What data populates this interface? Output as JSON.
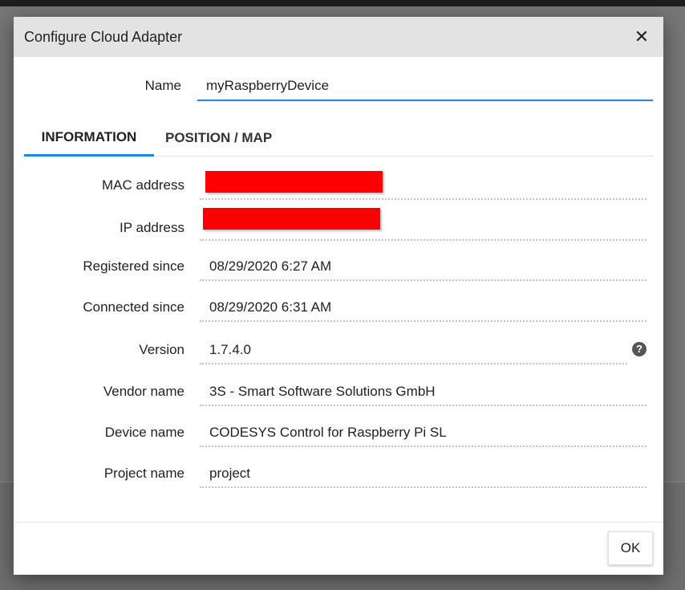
{
  "dialog": {
    "title": "Configure Cloud Adapter",
    "close_icon": "close-icon",
    "name_label": "Name",
    "name_value": "myRaspberryDevice",
    "tabs": [
      {
        "label": "INFORMATION",
        "active": true
      },
      {
        "label": "POSITION / MAP",
        "active": false
      }
    ],
    "fields": [
      {
        "label": "MAC address",
        "value": "",
        "redacted": true
      },
      {
        "label": "IP address",
        "value": "",
        "redacted": true
      },
      {
        "label": "Registered since",
        "value": "08/29/2020 6:27 AM"
      },
      {
        "label": "Connected since",
        "value": "08/29/2020 6:31 AM"
      },
      {
        "label": "Version",
        "value": "1.7.4.0",
        "help_icon": "help-icon"
      },
      {
        "label": "Vendor name",
        "value": "3S - Smart Software Solutions GmbH"
      },
      {
        "label": "Device name",
        "value": "CODESYS Control for Raspberry Pi SL"
      },
      {
        "label": "Project name",
        "value": "project"
      }
    ],
    "ok_label": "OK"
  },
  "colors": {
    "accent": "#1e88e5",
    "titlebar": "#e3e3e3",
    "redaction": "#ff0000",
    "overlay": "#6e6e6e"
  }
}
